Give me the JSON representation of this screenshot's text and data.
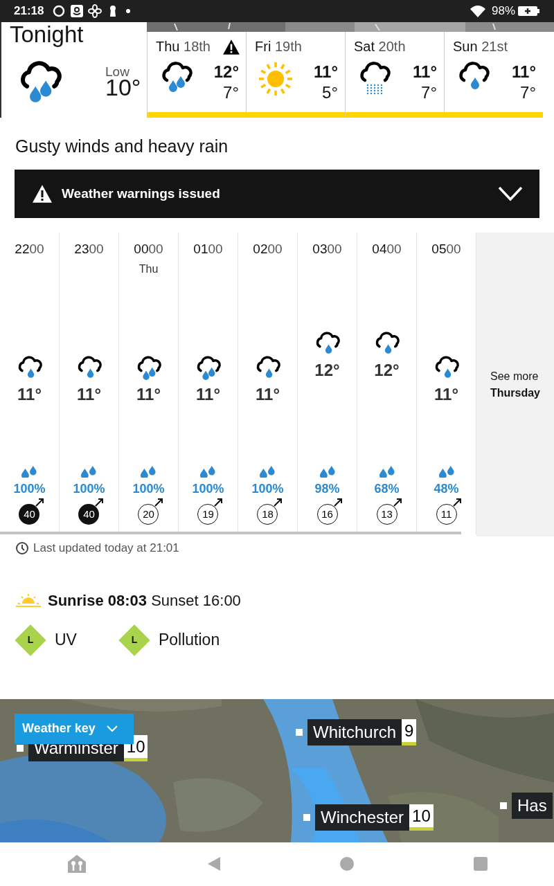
{
  "status_bar": {
    "time": "21:18",
    "battery": "98%"
  },
  "tonight": {
    "title": "Tonight",
    "kind": "heavy-rain",
    "low_label": "Low",
    "low": "10°",
    "selected": true
  },
  "days": [
    {
      "day": "Thu",
      "date": "18th",
      "kind": "heavy-rain",
      "high": "12°",
      "low": "7°",
      "warning": true,
      "selected": false
    },
    {
      "day": "Fri",
      "date": "19th",
      "kind": "sunny",
      "high": "11°",
      "low": "5°",
      "warning": false,
      "selected": false
    },
    {
      "day": "Sat",
      "date": "20th",
      "kind": "drizzle",
      "high": "11°",
      "low": "7°",
      "warning": false,
      "selected": false
    },
    {
      "day": "Sun",
      "date": "21st",
      "kind": "light-rain",
      "high": "11°",
      "low": "7°",
      "warning": false,
      "selected": false
    }
  ],
  "summary": "Gusty winds and heavy rain",
  "warning_bar": {
    "label": "Weather warnings issued",
    "expanded": false
  },
  "hours": [
    {
      "hour": "22",
      "minutes": "00",
      "kind": "light-rain",
      "temp": "11°",
      "rain": "100%",
      "wind": "40",
      "strong": true
    },
    {
      "hour": "23",
      "minutes": "00",
      "kind": "light-rain",
      "temp": "11°",
      "rain": "100%",
      "wind": "40",
      "strong": true
    },
    {
      "hour": "00",
      "minutes": "00",
      "day_label": "Thu",
      "kind": "heavy-rain",
      "temp": "11°",
      "rain": "100%",
      "wind": "20",
      "strong": false
    },
    {
      "hour": "01",
      "minutes": "00",
      "kind": "heavy-rain",
      "temp": "11°",
      "rain": "100%",
      "wind": "19",
      "strong": false
    },
    {
      "hour": "02",
      "minutes": "00",
      "kind": "light-rain",
      "temp": "11°",
      "rain": "100%",
      "wind": "18",
      "strong": false
    },
    {
      "hour": "03",
      "minutes": "00",
      "kind": "light-rain",
      "temp": "12°",
      "rain": "98%",
      "wind": "16",
      "strong": false
    },
    {
      "hour": "04",
      "minutes": "00",
      "kind": "light-rain",
      "temp": "12°",
      "rain": "68%",
      "wind": "13",
      "strong": false
    },
    {
      "hour": "05",
      "minutes": "00",
      "kind": "light-rain",
      "temp": "11°",
      "rain": "48%",
      "wind": "11",
      "strong": false
    }
  ],
  "see_more": {
    "text": "See more",
    "day": "Thursday"
  },
  "last_updated": "Last updated today at 21:01",
  "sun": "**Sunrise 08:03** Sunset 16:00",
  "indices": [
    {
      "level": "L",
      "label": "UV"
    },
    {
      "level": "L",
      "label": "Pollution"
    }
  ],
  "map": {
    "key_button": "Weather key",
    "expanded": false,
    "places": [
      {
        "name": "Warminster",
        "temp": "10"
      },
      {
        "name": "Whitchurch",
        "temp": "9"
      },
      {
        "name": "Winchester",
        "temp": "10"
      },
      {
        "name": "Has"
      }
    ]
  }
}
